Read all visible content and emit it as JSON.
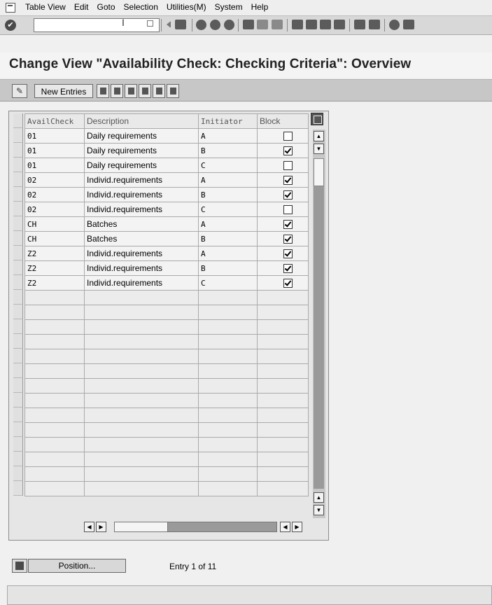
{
  "menu": {
    "items": [
      "Table View",
      "Edit",
      "Goto",
      "Selection",
      "Utilities(M)",
      "System",
      "Help"
    ]
  },
  "toolbar": {
    "command_field_value": "",
    "icons": [
      "enter-icon",
      "back-icon",
      "exit-icon",
      "cancel-icon",
      "print-icon",
      "find-icon",
      "find-next-icon",
      "first-page-icon",
      "previous-page-icon",
      "next-page-icon",
      "last-page-icon",
      "create-session-icon",
      "shortcut-icon",
      "help-icon",
      "layout-icon"
    ]
  },
  "page": {
    "title": "Change View \"Availability Check: Checking Criteria\": Overview"
  },
  "app_toolbar": {
    "new_entries_label": "New Entries"
  },
  "table": {
    "columns": [
      "AvailCheck",
      "Description",
      "Initiator",
      "Block"
    ],
    "rows": [
      {
        "availcheck": "01",
        "description": "Daily requirements",
        "initiator": "A",
        "block": false
      },
      {
        "availcheck": "01",
        "description": "Daily requirements",
        "initiator": "B",
        "block": true
      },
      {
        "availcheck": "01",
        "description": "Daily requirements",
        "initiator": "C",
        "block": false
      },
      {
        "availcheck": "02",
        "description": "Individ.requirements",
        "initiator": "A",
        "block": true
      },
      {
        "availcheck": "02",
        "description": "Individ.requirements",
        "initiator": "B",
        "block": true
      },
      {
        "availcheck": "02",
        "description": "Individ.requirements",
        "initiator": "C",
        "block": false
      },
      {
        "availcheck": "CH",
        "description": "Batches",
        "initiator": "A",
        "block": true
      },
      {
        "availcheck": "CH",
        "description": "Batches",
        "initiator": "B",
        "block": true
      },
      {
        "availcheck": "Z2",
        "description": "Individ.requirements",
        "initiator": "A",
        "block": true
      },
      {
        "availcheck": "Z2",
        "description": "Individ.requirements",
        "initiator": "B",
        "block": true
      },
      {
        "availcheck": "Z2",
        "description": "Individ.requirements",
        "initiator": "C",
        "block": true
      }
    ],
    "empty_rows": 14
  },
  "footer": {
    "position_label": "Position...",
    "entry_info": "Entry 1 of 11"
  },
  "status": {
    "message": ""
  }
}
